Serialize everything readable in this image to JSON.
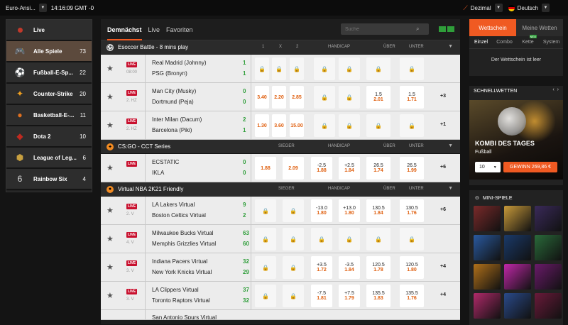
{
  "topbar": {
    "region": "Euro-Ansi...",
    "time": "14:16:09 GMT -0",
    "odds_format": "Dezimal",
    "language": "Deutsch"
  },
  "sidebar": {
    "items": [
      {
        "label": "Live",
        "count": "",
        "icon": "live-dot-icon"
      },
      {
        "label": "Alle Spiele",
        "count": "73",
        "icon": "gamepad-icon"
      },
      {
        "label": "Fußball-E-Sp...",
        "count": "22",
        "icon": "football-icon"
      },
      {
        "label": "Counter-Strike",
        "count": "20",
        "icon": "counter-strike-icon"
      },
      {
        "label": "Basketball-E-...",
        "count": "11",
        "icon": "basketball-icon"
      },
      {
        "label": "Dota 2",
        "count": "10",
        "icon": "dota2-icon"
      },
      {
        "label": "League of Leg...",
        "count": "6",
        "icon": "lol-icon"
      },
      {
        "label": "Rainbow Six",
        "count": "4",
        "icon": "rainbow-six-icon"
      }
    ]
  },
  "main": {
    "tabs": [
      "Demnächst",
      "Live",
      "Favoriten"
    ],
    "search_placeholder": "Suche",
    "leagues": [
      {
        "name": "Esoccer Battle - 8 mins play",
        "cols": [
          "1",
          "X",
          "2",
          "HANDICAP",
          "ÜBER",
          "UNTER"
        ]
      },
      {
        "name": "CS:GO - CCT Series",
        "cols": [
          "SIEGER",
          "HANDICAP",
          "ÜBER",
          "UNTER"
        ]
      },
      {
        "name": "Virtual NBA 2K21 Friendly",
        "cols": [
          "SIEGER",
          "HANDICAP",
          "ÜBER",
          "UNTER"
        ]
      }
    ],
    "matches": [
      {
        "league": 0,
        "meta": "08:00",
        "home": "Real Madrid (Johnny)",
        "away": "PSG (Bronyn)",
        "sh": "1",
        "sa": "1",
        "more": "",
        "cells": [
          [
            "lock"
          ],
          [
            "lock"
          ],
          [
            "lock"
          ],
          [
            "lock"
          ],
          [
            "lock"
          ],
          [
            "lock"
          ],
          [
            "lock"
          ]
        ]
      },
      {
        "league": 0,
        "meta": "2. HZ",
        "home": "Man City (Musky)",
        "away": "Dortmund (Peja)",
        "sh": "0",
        "sa": "0",
        "more": "+3",
        "cells": [
          [
            "3.40"
          ],
          [
            "2.20"
          ],
          [
            "2.85"
          ],
          [
            "lock"
          ],
          [
            "lock"
          ],
          [
            "1.5",
            "2.01"
          ],
          [
            "1.5",
            "1.71"
          ]
        ]
      },
      {
        "league": 0,
        "meta": "2. HZ",
        "home": "Inter Milan (Dacum)",
        "away": "Barcelona (Piki)",
        "sh": "2",
        "sa": "1",
        "more": "+1",
        "cells": [
          [
            "1.30"
          ],
          [
            "3.60"
          ],
          [
            "15.00"
          ],
          [
            "lock"
          ],
          [
            "lock"
          ],
          [
            "lock"
          ],
          [
            "lock"
          ]
        ]
      },
      {
        "league": 1,
        "meta": "",
        "home": "ECSTATIC",
        "away": "IKLA",
        "sh": "0",
        "sa": "0",
        "more": "+6",
        "cells": [
          [
            "1.88"
          ],
          [
            "2.09"
          ],
          [
            "-2.5",
            "1.88"
          ],
          [
            "+2.5",
            "1.84"
          ],
          [
            "26.5",
            "1.74"
          ],
          [
            "26.5",
            "1.99"
          ]
        ]
      },
      {
        "league": 2,
        "meta": "2. V",
        "home": "LA Lakers Virtual",
        "away": "Boston Celtics Virtual",
        "sh": "9",
        "sa": "2",
        "more": "+6",
        "cells": [
          [
            "lock"
          ],
          [
            "lock"
          ],
          [
            "-13.0",
            "1.80"
          ],
          [
            "+13.0",
            "1.80"
          ],
          [
            "130.5",
            "1.84"
          ],
          [
            "130.5",
            "1.76"
          ]
        ]
      },
      {
        "league": 2,
        "meta": "4. V",
        "home": "Milwaukee Bucks Virtual",
        "away": "Memphis Grizzlies Virtual",
        "sh": "63",
        "sa": "60",
        "more": "",
        "cells": [
          [
            "lock"
          ],
          [
            "lock"
          ],
          [
            "lock"
          ],
          [
            "lock"
          ],
          [
            "lock"
          ],
          [
            "lock"
          ]
        ]
      },
      {
        "league": 2,
        "meta": "3. V",
        "home": "Indiana Pacers Virtual",
        "away": "New York Knicks Virtual",
        "sh": "32",
        "sa": "29",
        "more": "+4",
        "cells": [
          [
            "lock"
          ],
          [
            "lock"
          ],
          [
            "+3.5",
            "1.72"
          ],
          [
            "-3.5",
            "1.84"
          ],
          [
            "120.5",
            "1.78"
          ],
          [
            "120.5",
            "1.80"
          ]
        ]
      },
      {
        "league": 2,
        "meta": "3. V",
        "home": "LA Clippers Virtual",
        "away": "Toronto Raptors Virtual",
        "sh": "37",
        "sa": "32",
        "more": "+4",
        "cells": [
          [
            "lock"
          ],
          [
            "lock"
          ],
          [
            "-7.5",
            "1.81"
          ],
          [
            "+7.5",
            "1.79"
          ],
          [
            "135.5",
            "1.83"
          ],
          [
            "135.5",
            "1.76"
          ]
        ]
      }
    ],
    "partial_row": "San Antonio Spurs Virtual"
  },
  "betslip": {
    "tabs": [
      "Wettschein",
      "Meine Wetten"
    ],
    "sub": [
      "Einzel",
      "Combo",
      "Kette",
      "System"
    ],
    "new_badge": "NEU",
    "empty": "Der Wettschein ist leer"
  },
  "quick": {
    "title": "SCHNELLWETTEN",
    "banner_title": "KOMBI DES TAGES",
    "banner_sub": "Fußball",
    "stake": "10",
    "win": "GEWINN 269,86 €"
  },
  "mini": {
    "title": "MINI-SPIELE",
    "tiles": [
      "#7a2a2a",
      "#c89a3a",
      "#3a2a5a",
      "#2a5aa0",
      "#1a3a6a",
      "#2a6a3a",
      "#b0701a",
      "#c028a8",
      "#6a1a6a",
      "#b02a6a",
      "#2a4a8a",
      "#6a1a3a"
    ]
  },
  "colors": {
    "accent": "#f05a22",
    "score": "#2f9e3a",
    "odds": "#e06010",
    "live": "#c8102e"
  }
}
